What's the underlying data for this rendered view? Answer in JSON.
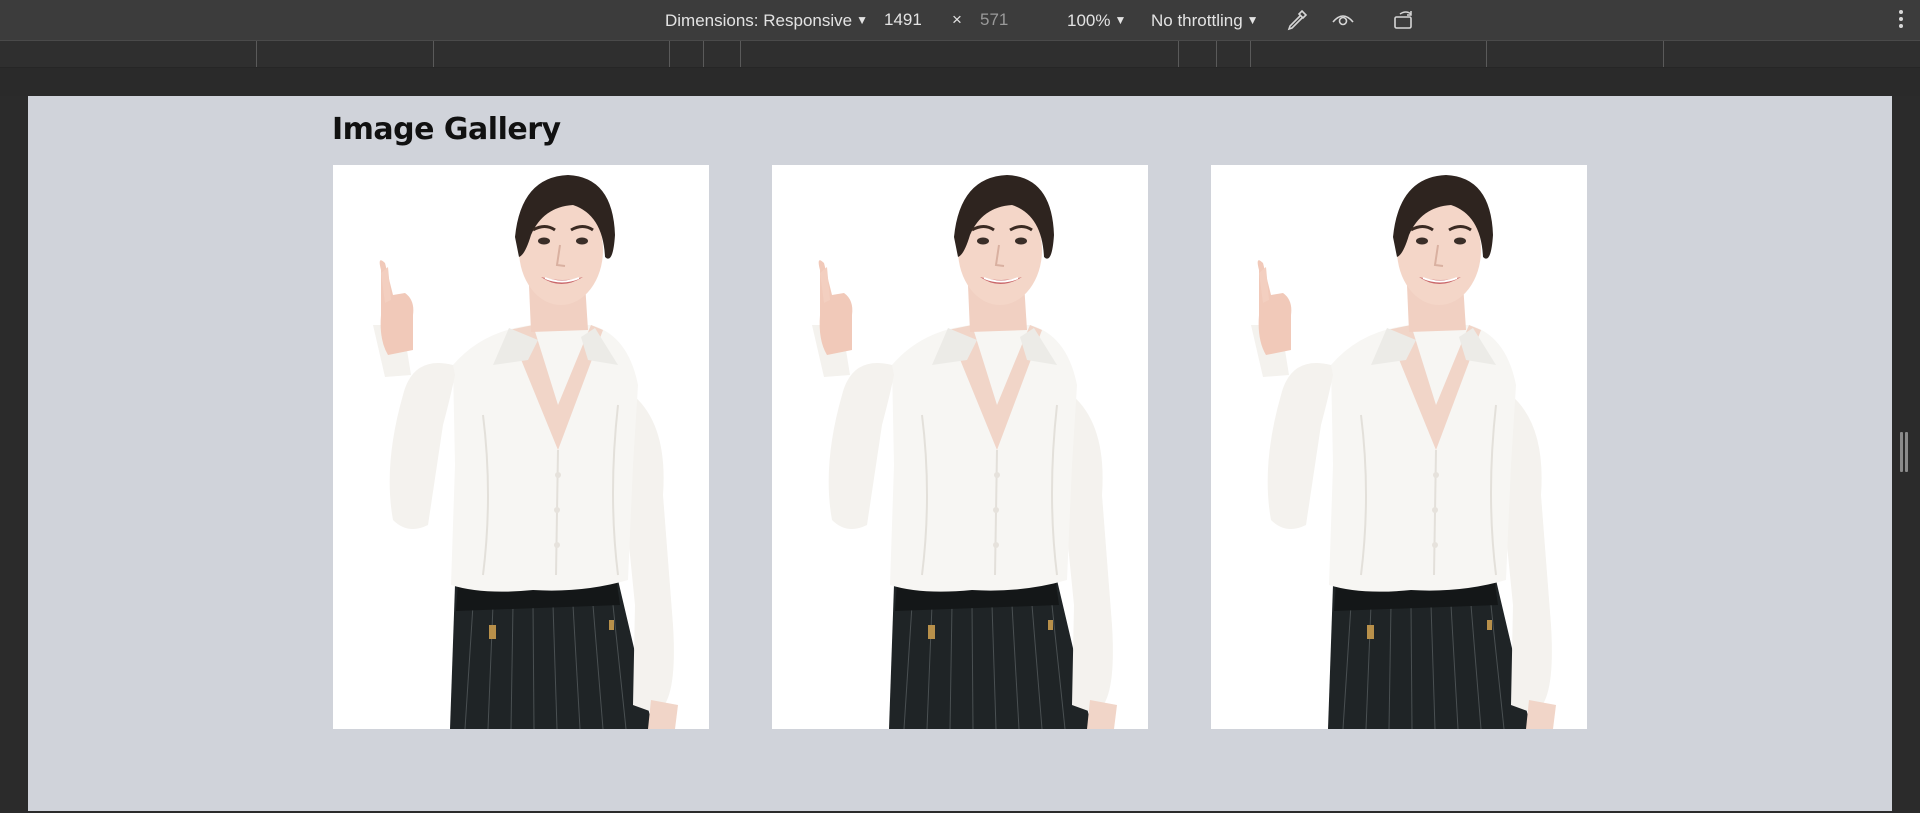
{
  "toolbar": {
    "dimensions_label": "Dimensions: Responsive",
    "width_value": "1491",
    "times": "×",
    "height_value": "571",
    "zoom_label": "100%",
    "throttle_label": "No throttling",
    "icons": [
      "eyedropper-icon",
      "eye-icon",
      "rotate-icon",
      "more-vert-icon"
    ]
  },
  "page": {
    "title": "Image Gallery",
    "images": [
      {
        "alt": "woman-pointing-up"
      },
      {
        "alt": "woman-pointing-up"
      },
      {
        "alt": "woman-pointing-up"
      }
    ]
  },
  "colors": {
    "toolbar_bg": "#3c3c3c",
    "viewport_bg": "#d0d3da",
    "photo_bg": "#ffffff"
  }
}
